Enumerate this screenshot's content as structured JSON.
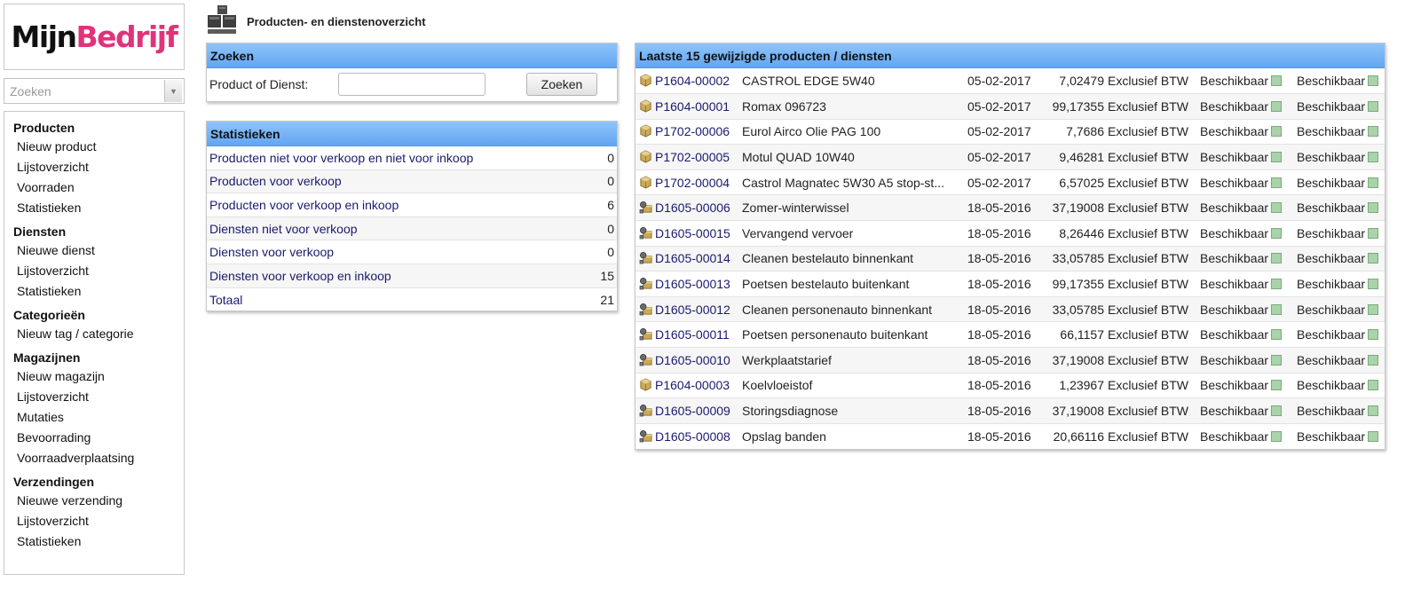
{
  "logo": {
    "part1": "Mijn",
    "part2": "Bedrijf"
  },
  "sidebar": {
    "search_placeholder": "Zoeken",
    "sections": [
      {
        "heading": "Producten",
        "items": [
          "Nieuw product",
          "Lijstoverzicht",
          "Voorraden",
          "Statistieken"
        ]
      },
      {
        "heading": "Diensten",
        "items": [
          "Nieuwe dienst",
          "Lijstoverzicht",
          "Statistieken"
        ]
      },
      {
        "heading": "Categorieën",
        "items": [
          "Nieuw tag / categorie"
        ]
      },
      {
        "heading": "Magazijnen",
        "items": [
          "Nieuw magazijn",
          "Lijstoverzicht",
          "Mutaties",
          "Bevoorrading",
          "Voorraadverplaatsing"
        ]
      },
      {
        "heading": "Verzendingen",
        "items": [
          "Nieuwe verzending",
          "Lijstoverzicht",
          "Statistieken"
        ]
      }
    ]
  },
  "page": {
    "title": "Producten- en dienstenoverzicht"
  },
  "search": {
    "header": "Zoeken",
    "label": "Product of Dienst:",
    "value": "",
    "button": "Zoeken"
  },
  "stats": {
    "header": "Statistieken",
    "rows": [
      {
        "label": "Producten niet voor verkoop en niet voor inkoop",
        "value": "0"
      },
      {
        "label": "Producten voor verkoop",
        "value": "0"
      },
      {
        "label": "Producten voor verkoop en inkoop",
        "value": "6"
      },
      {
        "label": "Diensten niet voor verkoop",
        "value": "0"
      },
      {
        "label": "Diensten voor verkoop",
        "value": "0"
      },
      {
        "label": "Diensten voor verkoop en inkoop",
        "value": "15"
      },
      {
        "label": "Totaal",
        "value": "21"
      }
    ]
  },
  "recent": {
    "header": "Laatste 15 gewijzigde producten / diensten",
    "status_color": "#a9d3a9",
    "rows": [
      {
        "type": "product",
        "code": "P1604-00002",
        "name": "CASTROL EDGE 5W40",
        "date": "05-02-2017",
        "price": "7,02479",
        "vat": "Exclusief BTW",
        "sell": "Beschikbaar",
        "buy": "Beschikbaar"
      },
      {
        "type": "product",
        "code": "P1604-00001",
        "name": "Romax 096723",
        "date": "05-02-2017",
        "price": "99,17355",
        "vat": "Exclusief BTW",
        "sell": "Beschikbaar",
        "buy": "Beschikbaar"
      },
      {
        "type": "product",
        "code": "P1702-00006",
        "name": "Eurol Airco Olie PAG 100",
        "date": "05-02-2017",
        "price": "7,7686",
        "vat": "Exclusief BTW",
        "sell": "Beschikbaar",
        "buy": "Beschikbaar"
      },
      {
        "type": "product",
        "code": "P1702-00005",
        "name": "Motul QUAD 10W40",
        "date": "05-02-2017",
        "price": "9,46281",
        "vat": "Exclusief BTW",
        "sell": "Beschikbaar",
        "buy": "Beschikbaar"
      },
      {
        "type": "product",
        "code": "P1702-00004",
        "name": "Castrol Magnatec 5W30 A5 stop-st...",
        "date": "05-02-2017",
        "price": "6,57025",
        "vat": "Exclusief BTW",
        "sell": "Beschikbaar",
        "buy": "Beschikbaar"
      },
      {
        "type": "service",
        "code": "D1605-00006",
        "name": "Zomer-winterwissel",
        "date": "18-05-2016",
        "price": "37,19008",
        "vat": "Exclusief BTW",
        "sell": "Beschikbaar",
        "buy": "Beschikbaar"
      },
      {
        "type": "service",
        "code": "D1605-00015",
        "name": "Vervangend vervoer",
        "date": "18-05-2016",
        "price": "8,26446",
        "vat": "Exclusief BTW",
        "sell": "Beschikbaar",
        "buy": "Beschikbaar"
      },
      {
        "type": "service",
        "code": "D1605-00014",
        "name": "Cleanen bestelauto binnenkant",
        "date": "18-05-2016",
        "price": "33,05785",
        "vat": "Exclusief BTW",
        "sell": "Beschikbaar",
        "buy": "Beschikbaar"
      },
      {
        "type": "service",
        "code": "D1605-00013",
        "name": "Poetsen bestelauto buitenkant",
        "date": "18-05-2016",
        "price": "99,17355",
        "vat": "Exclusief BTW",
        "sell": "Beschikbaar",
        "buy": "Beschikbaar"
      },
      {
        "type": "service",
        "code": "D1605-00012",
        "name": "Cleanen personenauto binnenkant",
        "date": "18-05-2016",
        "price": "33,05785",
        "vat": "Exclusief BTW",
        "sell": "Beschikbaar",
        "buy": "Beschikbaar"
      },
      {
        "type": "service",
        "code": "D1605-00011",
        "name": "Poetsen personenauto buitenkant",
        "date": "18-05-2016",
        "price": "66,1157",
        "vat": "Exclusief BTW",
        "sell": "Beschikbaar",
        "buy": "Beschikbaar"
      },
      {
        "type": "service",
        "code": "D1605-00010",
        "name": "Werkplaatstarief",
        "date": "18-05-2016",
        "price": "37,19008",
        "vat": "Exclusief BTW",
        "sell": "Beschikbaar",
        "buy": "Beschikbaar"
      },
      {
        "type": "product",
        "code": "P1604-00003",
        "name": "Koelvloeistof",
        "date": "18-05-2016",
        "price": "1,23967",
        "vat": "Exclusief BTW",
        "sell": "Beschikbaar",
        "buy": "Beschikbaar"
      },
      {
        "type": "service",
        "code": "D1605-00009",
        "name": "Storingsdiagnose",
        "date": "18-05-2016",
        "price": "37,19008",
        "vat": "Exclusief BTW",
        "sell": "Beschikbaar",
        "buy": "Beschikbaar"
      },
      {
        "type": "service",
        "code": "D1605-00008",
        "name": "Opslag banden",
        "date": "18-05-2016",
        "price": "20,66116",
        "vat": "Exclusief BTW",
        "sell": "Beschikbaar",
        "buy": "Beschikbaar"
      }
    ]
  }
}
